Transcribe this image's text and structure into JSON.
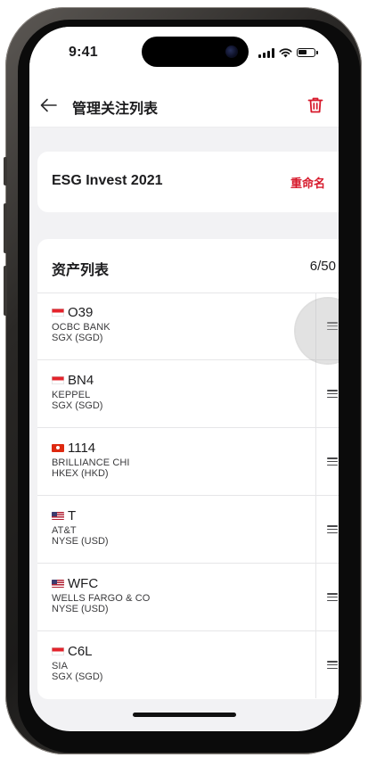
{
  "status_bar": {
    "time": "9:41"
  },
  "header": {
    "title": "管理关注列表",
    "back_icon": "arrow-left-icon",
    "delete_icon": "trash-icon"
  },
  "watchlist": {
    "name": "ESG Invest 2021",
    "rename_label": "重命名"
  },
  "assets": {
    "title": "资产列表",
    "count": "6/50",
    "items": [
      {
        "flag": "sg",
        "ticker": "O39",
        "name": "OCBC BANK",
        "exchange": "SGX (SGD)"
      },
      {
        "flag": "sg",
        "ticker": "BN4",
        "name": "KEPPEL",
        "exchange": "SGX (SGD)"
      },
      {
        "flag": "hk",
        "ticker": "1114",
        "name": "BRILLIANCE CHI",
        "exchange": "HKEX (HKD)"
      },
      {
        "flag": "us",
        "ticker": "T",
        "name": "AT&T",
        "exchange": "NYSE (USD)"
      },
      {
        "flag": "us",
        "ticker": "WFC",
        "name": "WELLS FARGO & CO",
        "exchange": "NYSE (USD)"
      },
      {
        "flag": "sg",
        "ticker": "C6L",
        "name": "SIA",
        "exchange": "SGX (SGD)"
      }
    ]
  },
  "colors": {
    "accent": "#d7192b",
    "background": "#f2f2f4",
    "text": "#1c1c1e"
  }
}
